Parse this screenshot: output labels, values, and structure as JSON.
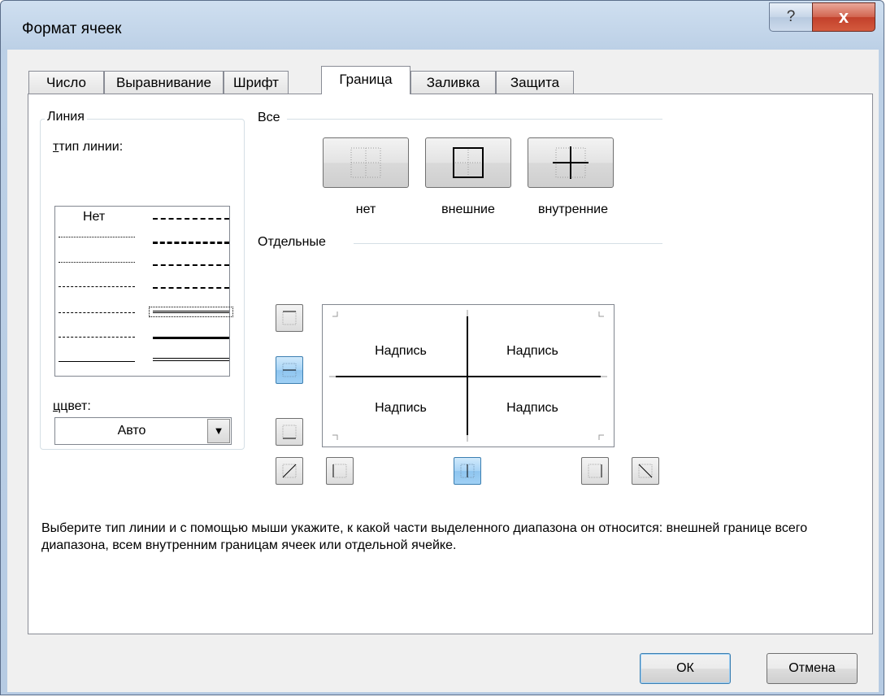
{
  "window": {
    "title": "Формат ячеек",
    "help_label": "?",
    "close_label": "x"
  },
  "tabs": [
    {
      "label": "Число",
      "active": false
    },
    {
      "label": "Выравнивание",
      "active": false
    },
    {
      "label": "Шрифт",
      "active": false
    },
    {
      "label": "Граница",
      "active": true
    },
    {
      "label": "Заливка",
      "active": false
    },
    {
      "label": "Защита",
      "active": false
    }
  ],
  "line_group": {
    "title": "Линия",
    "style_label": "тип линии:",
    "none_label": "Нет",
    "color_label": "цвет:",
    "color_value": "Авто"
  },
  "presets": {
    "title": "Все",
    "none_label": "нет",
    "outline_label": "внешние",
    "inside_label": "внутренние"
  },
  "border": {
    "title": "Отдельные",
    "preview_texts": [
      "Надпись",
      "Надпись",
      "Надпись",
      "Надпись"
    ]
  },
  "description": "Выберите тип линии и с помощью мыши укажите, к какой части выделенного диапазона он относится: внешней границе всего диапазона, всем внутренним границам ячеек или отдельной ячейке.",
  "buttons": {
    "ok": "ОК",
    "cancel": "Отмена"
  },
  "colors": {
    "accent": "#3c7fb1",
    "active_button": "#a7d4f6",
    "panel_bg": "#ffffff",
    "dialog_bg": "#f0f0f0"
  }
}
